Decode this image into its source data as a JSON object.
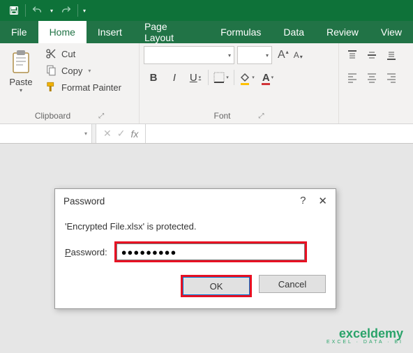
{
  "titlebar": {
    "save_icon": "save",
    "undo_icon": "undo",
    "redo_icon": "redo"
  },
  "tabs": {
    "file": "File",
    "home": "Home",
    "insert": "Insert",
    "page_layout": "Page Layout",
    "formulas": "Formulas",
    "data": "Data",
    "review": "Review",
    "view": "View"
  },
  "ribbon": {
    "clipboard": {
      "paste": "Paste",
      "cut": "Cut",
      "copy": "Copy",
      "format_painter": "Format Painter",
      "group_label": "Clipboard"
    },
    "font": {
      "increase": "A",
      "decrease": "A",
      "bold": "B",
      "italic": "I",
      "underline": "U",
      "font_color": "A",
      "group_label": "Font"
    },
    "alignment": {}
  },
  "formula_bar": {
    "name_box": "",
    "fx_label": "fx",
    "cancel": "✕",
    "enter": "✓"
  },
  "dialog": {
    "title": "Password",
    "message": "'Encrypted File.xlsx' is protected.",
    "password_label_char": "P",
    "password_label_rest": "assword:",
    "password_value": "●●●●●●●●●",
    "ok": "OK",
    "cancel": "Cancel",
    "help": "?",
    "close": "✕"
  },
  "watermark": {
    "brand": "exceldemy",
    "tagline": "EXCEL · DATA · BI"
  }
}
